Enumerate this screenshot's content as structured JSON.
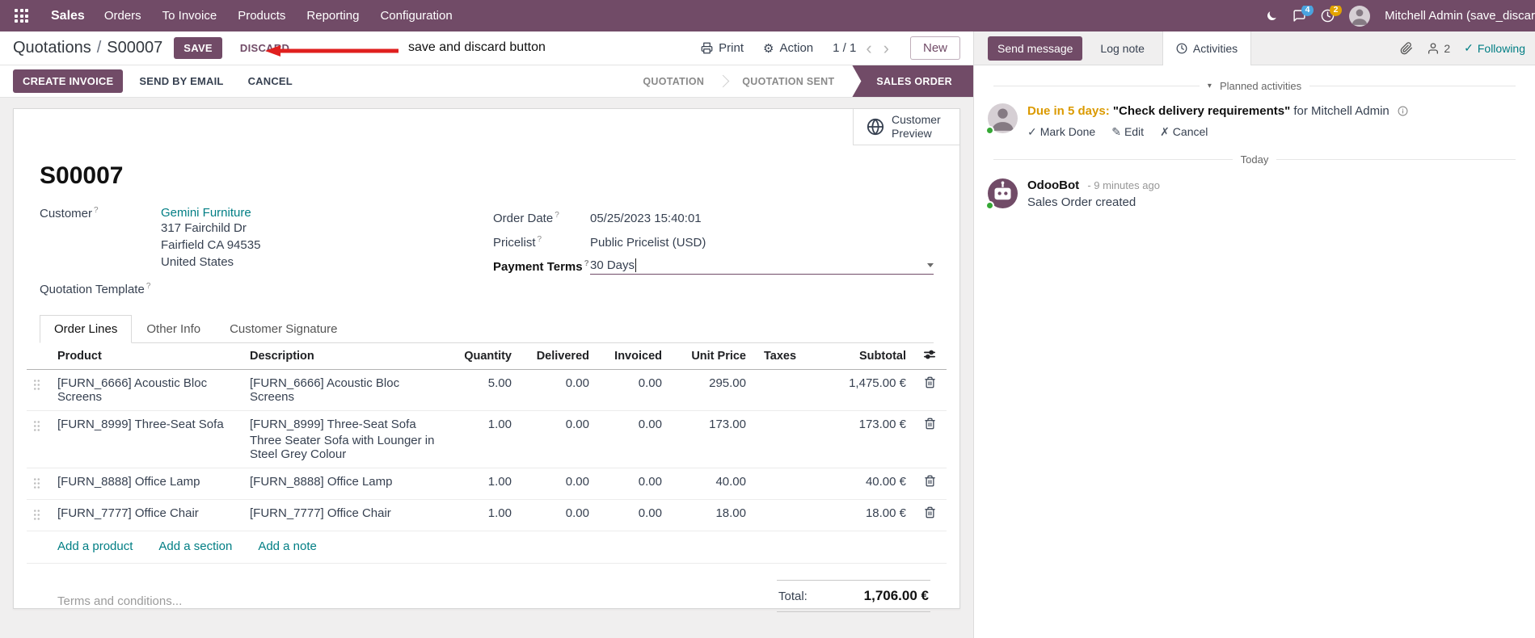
{
  "colors": {
    "primary": "#714B67",
    "link_teal": "#017e84",
    "modified_blue": "#2160c4",
    "due_warning": "#db9a00",
    "presence_green": "#35a835",
    "annotation_red": "#e0201f",
    "messages_badge_bg": "#4aa3df",
    "activities_badge_bg": "#e2a300"
  },
  "icons": {
    "gear": "⚙",
    "chevron_left": "‹",
    "chevron_right": "›",
    "caret_down": "▾",
    "check": "✓",
    "pencil": "✎",
    "cross": "✗",
    "breadcrumb_separator": "/",
    "help": "?"
  },
  "topbar": {
    "app_name": "Sales",
    "menus": [
      "Orders",
      "To Invoice",
      "Products",
      "Reporting",
      "Configuration"
    ],
    "messages_badge": "4",
    "activities_badge": "2",
    "user_name": "Mitchell Admin (save_discar"
  },
  "control_panel": {
    "breadcrumb_parent": "Quotations",
    "breadcrumb_current": "S00007",
    "save_label": "SAVE",
    "discard_label": "DISCARD",
    "annotation_text": "save and discard button",
    "print_label": "Print",
    "action_label": "Action",
    "pager_value": "1 / 1",
    "new_label": "New"
  },
  "statusbar": {
    "create_invoice": "CREATE INVOICE",
    "send_by_email": "SEND BY EMAIL",
    "cancel": "CANCEL",
    "states": [
      "QUOTATION",
      "QUOTATION SENT",
      "SALES ORDER"
    ],
    "active_state": "SALES ORDER"
  },
  "sheet": {
    "customer_preview": "Customer Preview",
    "title": "S00007",
    "customer_label": "Customer",
    "customer_name": "Gemini Furniture",
    "customer_address_1": "317 Fairchild Dr",
    "customer_address_2": "Fairfield CA 94535",
    "customer_address_3": "United States",
    "quotation_template_label": "Quotation Template",
    "order_date_label": "Order Date",
    "order_date_value": "05/25/2023 15:40:01",
    "pricelist_label": "Pricelist",
    "pricelist_value": "Public Pricelist (USD)",
    "payment_terms_label": "Payment Terms",
    "payment_terms_value": "30 Days"
  },
  "tabs": {
    "order_lines": "Order Lines",
    "other_info": "Other Info",
    "customer_signature": "Customer Signature"
  },
  "order_lines": {
    "columns": [
      "Product",
      "Description",
      "Quantity",
      "Delivered",
      "Invoiced",
      "Unit Price",
      "Taxes",
      "Subtotal"
    ],
    "rows": [
      {
        "product": "[FURN_6666] Acoustic Bloc Screens",
        "description": "[FURN_6666] Acoustic Bloc Screens",
        "description_line2": "",
        "quantity": "5.00",
        "delivered": "0.00",
        "invoiced": "0.00",
        "unit_price": "295.00",
        "taxes": "",
        "subtotal": "1,475.00 €"
      },
      {
        "product": "[FURN_8999] Three-Seat Sofa",
        "description": "[FURN_8999] Three-Seat Sofa",
        "description_line2": "Three Seater Sofa with Lounger in Steel Grey Colour",
        "quantity": "1.00",
        "delivered": "0.00",
        "invoiced": "0.00",
        "unit_price": "173.00",
        "taxes": "",
        "subtotal": "173.00 €"
      },
      {
        "product": "[FURN_8888] Office Lamp",
        "description": "[FURN_8888] Office Lamp",
        "description_line2": "",
        "quantity": "1.00",
        "delivered": "0.00",
        "invoiced": "0.00",
        "unit_price": "40.00",
        "taxes": "",
        "subtotal": "40.00 €"
      },
      {
        "product": "[FURN_7777] Office Chair",
        "description": "[FURN_7777] Office Chair",
        "description_line2": "",
        "quantity": "1.00",
        "delivered": "0.00",
        "invoiced": "0.00",
        "unit_price": "18.00",
        "taxes": "",
        "subtotal": "18.00 €"
      }
    ]
  },
  "footer": {
    "add_product": "Add a product",
    "add_section": "Add a section",
    "add_note": "Add a note",
    "terms_placeholder": "Terms and conditions...",
    "total_label": "Total:",
    "total_value": "1,706.00 €"
  },
  "chatter": {
    "send_message": "Send message",
    "log_note": "Log note",
    "activities_tab": "Activities",
    "followers_count": "2",
    "following_label": "Following",
    "planned_activities": "Planned activities",
    "activity": {
      "due": "Due in 5 days:",
      "summary": "\"Check delivery requirements\"",
      "for_user": "for Mitchell Admin"
    },
    "actions": {
      "mark_done": "Mark Done",
      "edit": "Edit",
      "cancel": "Cancel"
    },
    "today_label": "Today",
    "message": {
      "author": "OdooBot",
      "time": "- 9 minutes ago",
      "body": "Sales Order created"
    }
  }
}
